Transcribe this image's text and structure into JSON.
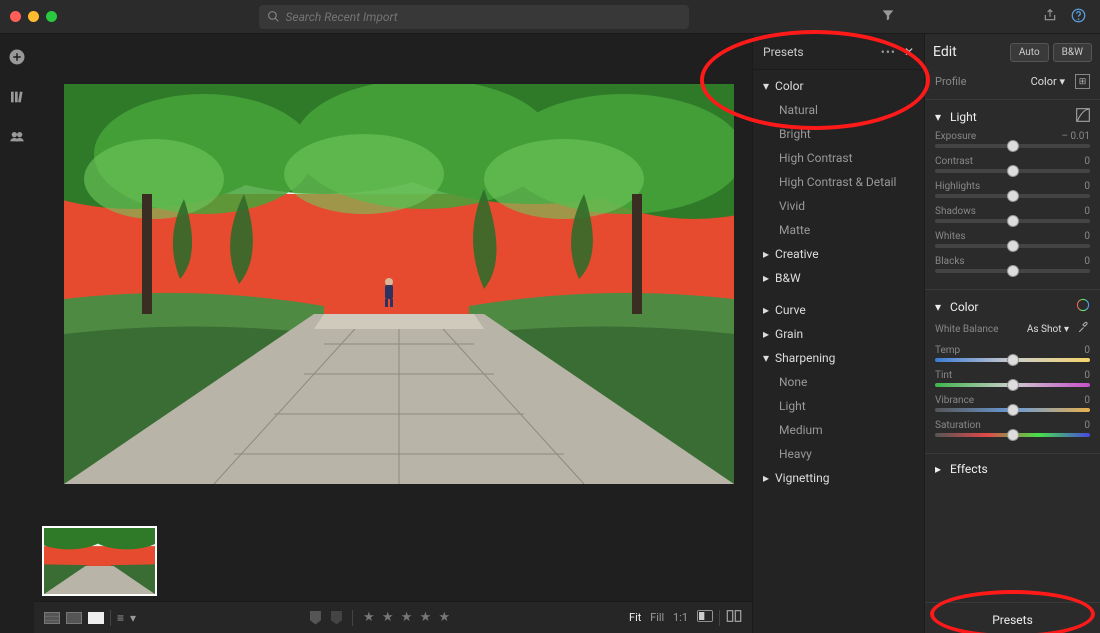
{
  "topbar": {
    "search_placeholder": "Search Recent Import"
  },
  "presets_panel": {
    "title": "Presets",
    "groups": {
      "color": "Color",
      "creative": "Creative",
      "bw": "B&W",
      "curve": "Curve",
      "grain": "Grain",
      "sharpening": "Sharpening",
      "vignetting": "Vignetting"
    },
    "color_items": [
      "Natural",
      "Bright",
      "High Contrast",
      "High Contrast & Detail",
      "Vivid",
      "Matte"
    ],
    "sharpen_items": [
      "None",
      "Light",
      "Medium",
      "Heavy"
    ]
  },
  "edit_panel": {
    "title": "Edit",
    "auto_label": "Auto",
    "bw_label": "B&W",
    "profile_label": "Profile",
    "profile_value": "Color",
    "light": {
      "title": "Light",
      "exposure": {
        "label": "Exposure",
        "value": "– 0.01"
      },
      "contrast": {
        "label": "Contrast",
        "value": "0"
      },
      "highlights": {
        "label": "Highlights",
        "value": "0"
      },
      "shadows": {
        "label": "Shadows",
        "value": "0"
      },
      "whites": {
        "label": "Whites",
        "value": "0"
      },
      "blacks": {
        "label": "Blacks",
        "value": "0"
      }
    },
    "color": {
      "title": "Color",
      "wb_label": "White Balance",
      "wb_value": "As Shot",
      "temp": {
        "label": "Temp",
        "value": "0"
      },
      "tint": {
        "label": "Tint",
        "value": "0"
      },
      "vibrance": {
        "label": "Vibrance",
        "value": "0"
      },
      "saturation": {
        "label": "Saturation",
        "value": "0"
      }
    },
    "effects_title": "Effects",
    "presets_btn": "Presets"
  },
  "bottombar": {
    "fit": "Fit",
    "fill": "Fill",
    "oneone": "1:1"
  }
}
